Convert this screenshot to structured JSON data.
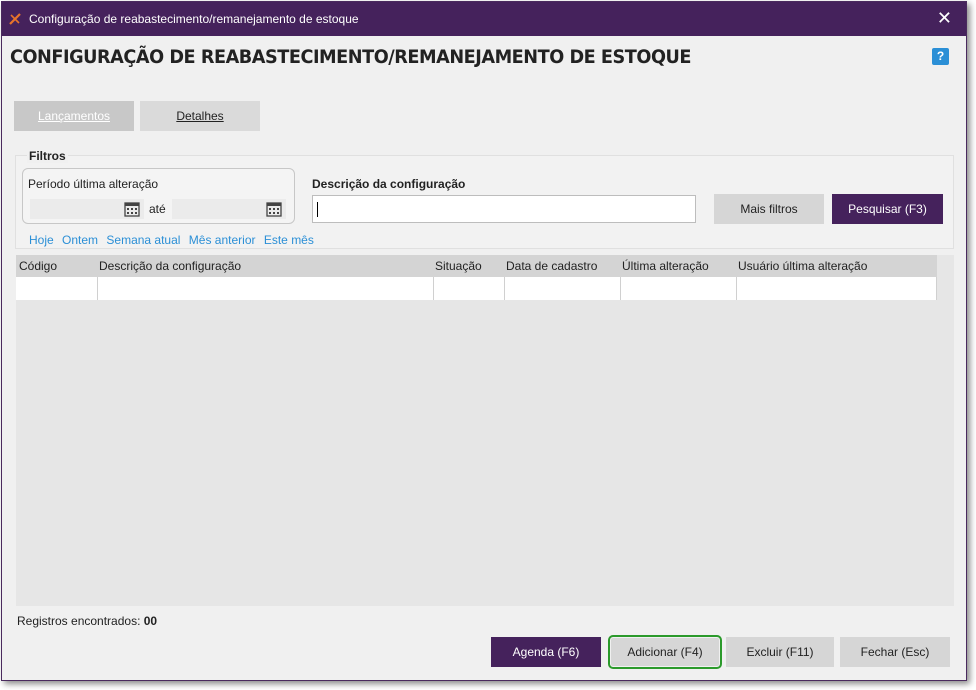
{
  "window": {
    "title": "Configuração de reabastecimento/remanejamento de estoque",
    "close_glyph": "✕"
  },
  "page": {
    "title": "CONFIGURAÇÃO DE REABASTECIMENTO/REMANEJAMENTO DE ESTOQUE",
    "help_glyph": "?"
  },
  "tabs": [
    {
      "label": "Lançamentos",
      "active": true
    },
    {
      "label": "Detalhes",
      "active": false
    }
  ],
  "filters": {
    "section_label": "Filtros",
    "period_label": "Período última alteração",
    "date_from_value": "",
    "date_to_value": "",
    "ate_label": "até",
    "quick_links": [
      "Hoje",
      "Ontem",
      "Semana atual",
      "Mês anterior",
      "Este mês"
    ],
    "description_label": "Descrição da configuração",
    "description_value": "",
    "mais_filtros_label": "Mais filtros",
    "pesquisar_label": "Pesquisar (F3)"
  },
  "grid": {
    "columns": [
      "Código",
      "Descrição da configuração",
      "Situação",
      "Data de cadastro",
      "Última alteração",
      "Usuário última alteração"
    ],
    "rows": [
      [
        "",
        "",
        "",
        "",
        "",
        ""
      ]
    ]
  },
  "footer": {
    "records_label": "Registros encontrados:",
    "records_count": "00",
    "agenda_label": "Agenda (F6)",
    "adicionar_label": "Adicionar (F4)",
    "excluir_label": "Excluir (F11)",
    "fechar_label": "Fechar (Esc)"
  },
  "colors": {
    "brand_purple": "#45225c",
    "link_blue": "#2b8fd6",
    "focus_green": "#2b9a2b"
  }
}
